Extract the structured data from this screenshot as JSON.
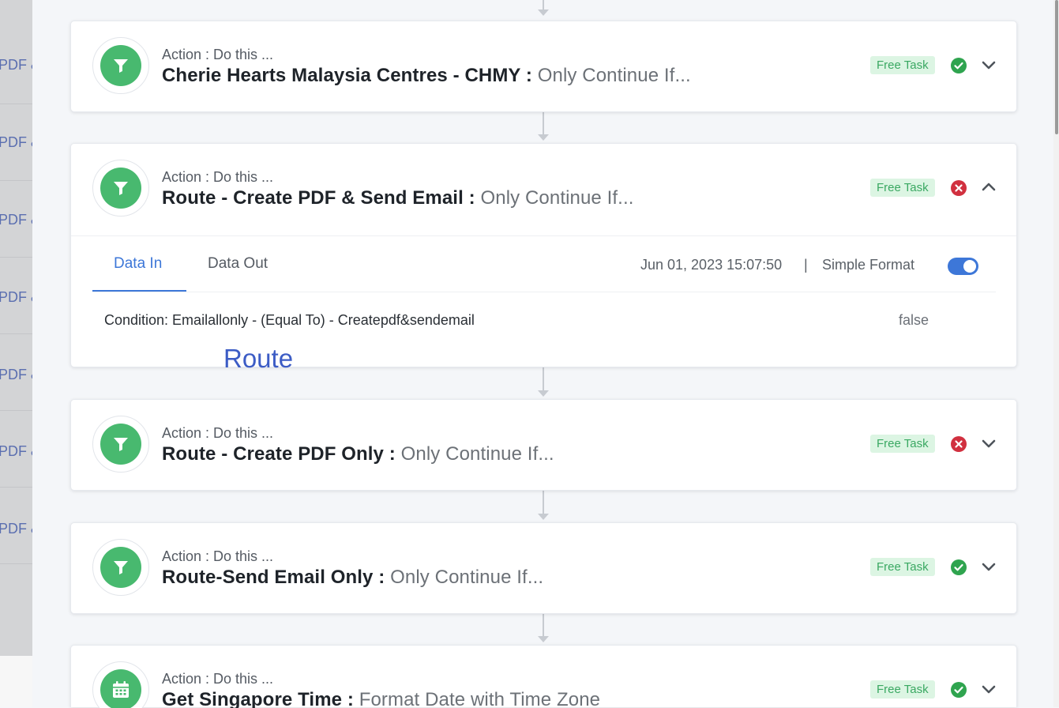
{
  "background": {
    "rows": [
      {
        "text": "PDF &"
      },
      {
        "text": "PDF &"
      },
      {
        "text": "PDF &"
      },
      {
        "text": "PDF &"
      },
      {
        "text": "PDF &"
      },
      {
        "text": "PDF &"
      },
      {
        "text": "PDF &"
      }
    ]
  },
  "steps": [
    {
      "sub_label": "Action : Do this ...",
      "title_main": "Cherie Hearts Malaysia Centres - CHMY :",
      "title_action": "Only Continue If...",
      "badge": "Free Task",
      "status": "success",
      "icon": "filter-icon",
      "expanded": false
    },
    {
      "sub_label": "Action : Do this ...",
      "title_main": "Route - Create PDF & Send Email :",
      "title_action": "Only Continue If...",
      "badge": "Free Task",
      "status": "error",
      "icon": "filter-icon",
      "expanded": true
    },
    {
      "sub_label": "Action : Do this ...",
      "title_main": "Route - Create PDF Only :",
      "title_action": "Only Continue If...",
      "badge": "Free Task",
      "status": "error",
      "icon": "filter-icon",
      "expanded": false
    },
    {
      "sub_label": "Action : Do this ...",
      "title_main": "Route-Send Email Only :",
      "title_action": "Only Continue If...",
      "badge": "Free Task",
      "status": "success",
      "icon": "filter-icon",
      "expanded": false
    },
    {
      "sub_label": "Action : Do this ...",
      "title_main": "Get Singapore Time :",
      "title_action": "Format Date with Time Zone",
      "badge": "Free Task",
      "status": "success",
      "icon": "calendar-icon",
      "expanded": false
    }
  ],
  "details": {
    "tabs": [
      {
        "label": "Data In",
        "active": true
      },
      {
        "label": "Data Out",
        "active": false
      }
    ],
    "timestamp": "Jun 01, 2023 15:07:50",
    "separator": "|",
    "simple_format_label": "Simple Format",
    "simple_format_on": true,
    "condition_text": "Condition: Emailallonly - (Equal To) - Createpdf&sendemail",
    "condition_value": "false",
    "overlay_text": "Route"
  },
  "colors": {
    "accent": "#3d77d8",
    "success": "#2fa44f",
    "error": "#d1303f",
    "icon_green": "#48b96f",
    "badge_bg": "#dcf5e3",
    "badge_text": "#3aa862"
  }
}
